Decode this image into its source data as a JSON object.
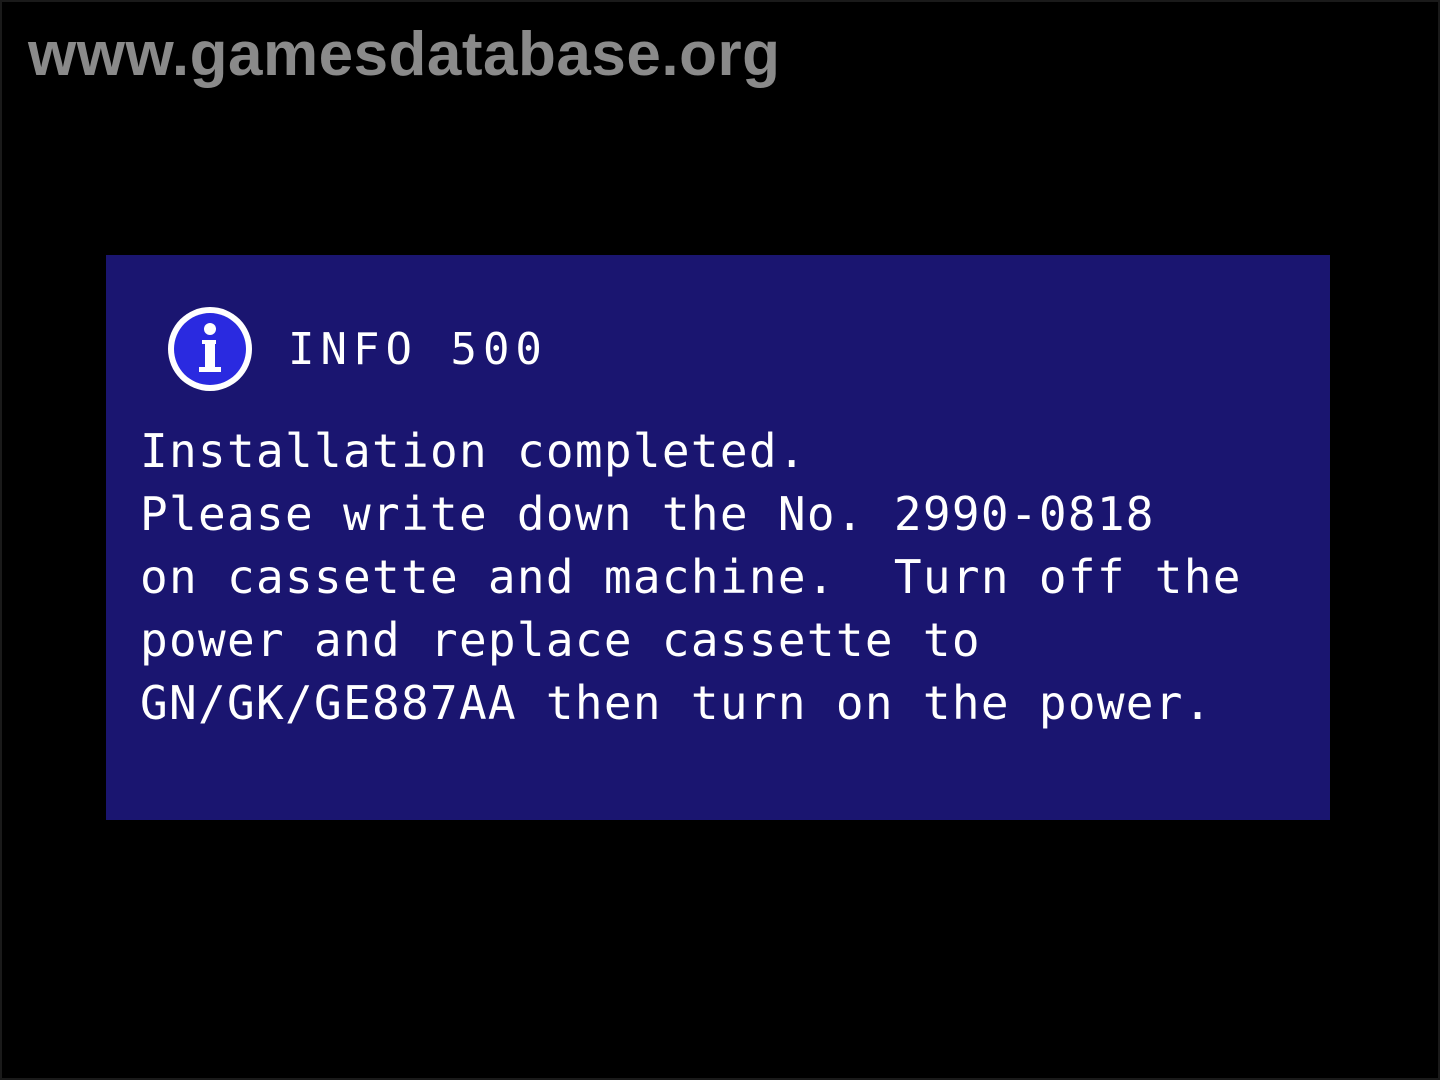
{
  "watermark": "www.gamesdatabase.org",
  "dialog": {
    "icon": "info-icon",
    "title": "INFO 500",
    "lines": [
      "Installation completed.",
      "Please write down the No. 2990-0818",
      "on cassette and machine.  Turn off the",
      "power and replace cassette to",
      "GN/GK/GE887AA then turn on the power."
    ]
  },
  "colors": {
    "background": "#000000",
    "panel": "#1a1570",
    "icon_fill": "#2a2ae0",
    "text": "#ffffff",
    "watermark": "#8a8a8a"
  }
}
